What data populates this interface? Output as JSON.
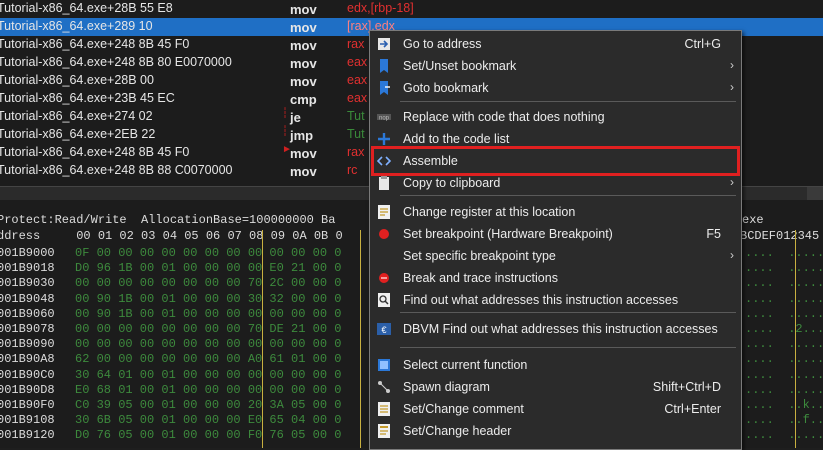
{
  "disasm": {
    "rows": [
      {
        "addr": "Tutorial-x86_64.exe+28B 55 E8",
        "op": "mov",
        "arg": "edx,[rbp-18]",
        "style": "mix1"
      },
      {
        "addr": "Tutorial-x86_64.exe+289 10",
        "op": "mov",
        "arg": "[rax],edx",
        "style": "sel"
      },
      {
        "addr": "Tutorial-x86_64.exe+248 8B 45 F0",
        "op": "mov",
        "arg": "rax",
        "style": "red"
      },
      {
        "addr": "Tutorial-x86_64.exe+248 8B 80 E0070000",
        "op": "mov",
        "arg": "eax",
        "style": "red"
      },
      {
        "addr": "Tutorial-x86_64.exe+28B 00",
        "op": "mov",
        "arg": "eax",
        "style": "red"
      },
      {
        "addr": "Tutorial-x86_64.exe+23B 45 EC",
        "op": "cmp",
        "arg": "eax",
        "style": "red"
      },
      {
        "addr": "Tutorial-x86_64.exe+274 02",
        "op": "je",
        "arg": "Tut",
        "style": "green"
      },
      {
        "addr": "Tutorial-x86_64.exe+2EB 22",
        "op": "jmp",
        "arg": "Tut",
        "style": "green"
      },
      {
        "addr": "Tutorial-x86_64.exe+248 8B 45 F0",
        "op": "mov",
        "arg": "rax",
        "style": "red"
      },
      {
        "addr": "Tutorial-x86_64.exe+248 8B 88 C0070000",
        "op": "mov",
        "arg": "rc",
        "style": "red"
      }
    ]
  },
  "hex": {
    "info_line": "Protect:Read/Write  AllocationBase=100000000 Ba",
    "info_tail": "exe",
    "header": "ddress     00 01 02 03 04 05 06 07 08 09 0A 0B 0",
    "header_tail": "BCDEF012345",
    "rows": [
      {
        "addr": "001B9000",
        "bytes": "0F 00 00 00 00 00 00 00 00 00 00 00 0",
        "ascii": "....  ....."
      },
      {
        "addr": "001B9018",
        "bytes": "D0 96 1B 00 01 00 00 00 00 E0 21 00 0",
        "ascii": "....  ....."
      },
      {
        "addr": "001B9030",
        "bytes": "00 00 00 00 00 00 00 00 70 2C 00 00 0",
        "ascii": "....  ....."
      },
      {
        "addr": "001B9048",
        "bytes": "00 90 1B 00 01 00 00 00 30 32 00 00 0",
        "ascii": "....  ....."
      },
      {
        "addr": "001B9060",
        "bytes": "00 90 1B 00 01 00 00 00 00 00 00 00 0",
        "ascii": "....  ....."
      },
      {
        "addr": "001B9078",
        "bytes": "00 00 00 00 00 00 00 00 70 DE 21 00 0",
        "ascii": "....  .2..."
      },
      {
        "addr": "001B9090",
        "bytes": "00 00 00 00 00 00 00 00 00 00 00 00 0",
        "ascii": "....  ....."
      },
      {
        "addr": "001B90A8",
        "bytes": "62 00 00 00 00 00 00 00 A0 61 01 00 0",
        "ascii": "....  ....."
      },
      {
        "addr": "001B90C0",
        "bytes": "30 64 01 00 01 00 00 00 00 00 00 00 0",
        "ascii": "....  ....."
      },
      {
        "addr": "001B90D8",
        "bytes": "E0 68 01 00 01 00 00 00 00 00 00 00 0",
        "ascii": "....  ....."
      },
      {
        "addr": "001B90F0",
        "bytes": "C0 39 05 00 01 00 00 00 20 3A 05 00 0",
        "ascii": "....  ..k.."
      },
      {
        "addr": "001B9108",
        "bytes": "30 6B 05 00 01 00 00 00 E0 65 04 00 0",
        "ascii": "....  ..f.."
      },
      {
        "addr": "001B9120",
        "bytes": "D0 76 05 00 01 00 00 00 F0 76 05 00 0",
        "ascii": "....  ....."
      }
    ]
  },
  "menu": {
    "items": [
      {
        "label": "Go to address",
        "shortcut": "Ctrl+G",
        "arrow": "",
        "icon": "goto-address-icon"
      },
      {
        "label": "Set/Unset bookmark",
        "shortcut": "",
        "arrow": "›",
        "icon": "bookmark-icon"
      },
      {
        "label": "Goto bookmark",
        "shortcut": "",
        "arrow": "›",
        "icon": "goto-bookmark-icon"
      },
      {
        "label": "Replace with code that does nothing",
        "shortcut": "",
        "arrow": "",
        "icon": "nop-icon"
      },
      {
        "label": "Add to the code list",
        "shortcut": "",
        "arrow": "",
        "icon": "plus-icon"
      },
      {
        "label": "Assemble",
        "shortcut": "",
        "arrow": "",
        "icon": "code-brackets-icon"
      },
      {
        "label": "Copy to clipboard",
        "shortcut": "",
        "arrow": "›",
        "icon": "clipboard-icon"
      },
      {
        "label": "Change register at this location",
        "shortcut": "",
        "arrow": "",
        "icon": "register-icon"
      },
      {
        "label": "Set breakpoint (Hardware Breakpoint)",
        "shortcut": "F5",
        "arrow": "",
        "icon": "breakpoint-icon"
      },
      {
        "label": "Set specific breakpoint type",
        "shortcut": "",
        "arrow": "›",
        "icon": ""
      },
      {
        "label": "Break and trace instructions",
        "shortcut": "",
        "arrow": "",
        "icon": "trace-icon"
      },
      {
        "label": "Find out what addresses this instruction accesses",
        "shortcut": "",
        "arrow": "",
        "icon": "find-addresses-icon"
      },
      {
        "label": "DBVM Find out what addresses this instruction accesses",
        "shortcut": "",
        "arrow": "",
        "icon": "dbvm-icon"
      },
      {
        "label": "Select current function",
        "shortcut": "",
        "arrow": "",
        "icon": "select-function-icon"
      },
      {
        "label": "Spawn diagram",
        "shortcut": "Shift+Ctrl+D",
        "arrow": "",
        "icon": "diagram-icon"
      },
      {
        "label": "Set/Change comment",
        "shortcut": "Ctrl+Enter",
        "arrow": "",
        "icon": "comment-icon"
      },
      {
        "label": "Set/Change header",
        "shortcut": "",
        "arrow": "",
        "icon": "header-icon"
      }
    ]
  },
  "colors": {
    "accent": "#1f6fc5",
    "highlight": "#e02020",
    "hexgreen": "#3d8a3d"
  }
}
